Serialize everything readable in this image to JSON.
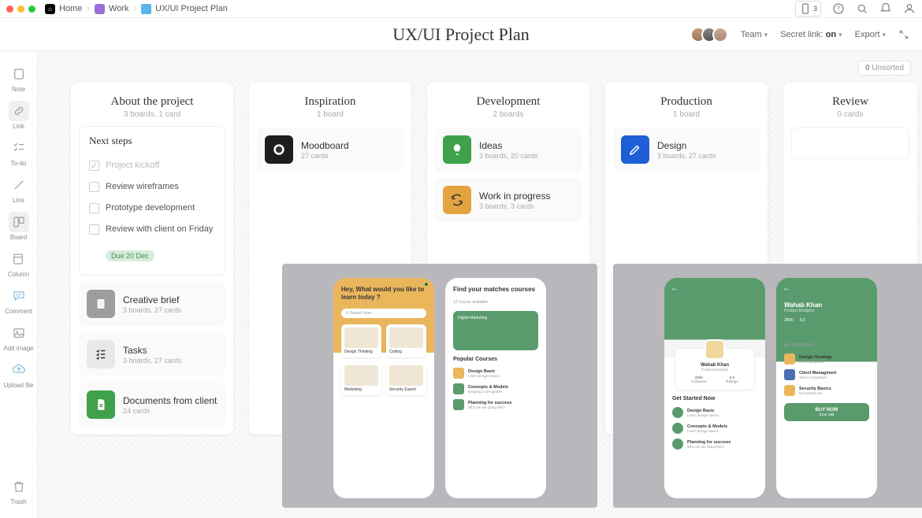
{
  "breadcrumb": {
    "home": "Home",
    "work": "Work",
    "project": "UX/UI Project Plan"
  },
  "device_count": "3",
  "page_title": "UX/UI Project Plan",
  "header": {
    "team": "Team",
    "secret": "Secret link:",
    "secret_state": "on",
    "export": "Export"
  },
  "sidebar": {
    "items": [
      "Note",
      "Link",
      "To-do",
      "Line",
      "Board",
      "Column",
      "Comment",
      "Add image",
      "Upload file"
    ],
    "trash": "Trash"
  },
  "unsorted": {
    "count": "0",
    "label": "Unsorted"
  },
  "columns": [
    {
      "title": "About the project",
      "sub": "3 boards, 1 card",
      "steps_title": "Next steps",
      "steps": [
        {
          "label": "Project kickoff",
          "done": true
        },
        {
          "label": "Review wireframes",
          "done": false
        },
        {
          "label": "Prototype development",
          "done": false
        },
        {
          "label": "Review with client on Friday",
          "done": false,
          "due": "Due 20 Dec"
        }
      ],
      "cards": [
        {
          "title": "Creative brief",
          "sub": "3 boards, 27 cards",
          "color": "#9d9d9d",
          "icon": "doc"
        },
        {
          "title": "Tasks",
          "sub": "3 boards, 27 cards",
          "color": "#e8e8e8",
          "icon": "checklist"
        },
        {
          "title": "Documents from client",
          "sub": "24 cards",
          "color": "#3fa24a",
          "icon": "file"
        }
      ]
    },
    {
      "title": "Inspiration",
      "sub": "1 board",
      "cards": [
        {
          "title": "Moodboard",
          "sub": "27 cards",
          "color": "#1e1e1e",
          "icon": "circle"
        }
      ]
    },
    {
      "title": "Development",
      "sub": "2 boards",
      "cards": [
        {
          "title": "Ideas",
          "sub": "3 boards, 20 cards",
          "color": "#3fa24a",
          "icon": "bulb"
        },
        {
          "title": "Work in progress",
          "sub": "3 boards, 3 cards",
          "color": "#e3a43f",
          "icon": "refresh"
        }
      ]
    },
    {
      "title": "Production",
      "sub": "1 board",
      "cards": [
        {
          "title": "Design",
          "sub": "3 boards, 27 cards",
          "color": "#1e5fd6",
          "icon": "pen"
        }
      ]
    },
    {
      "title": "Review",
      "sub": "0 cards",
      "cards": []
    }
  ],
  "mockups": {
    "phone1": {
      "hero": "Hey, What would you like to learn today ?",
      "search": "Search here",
      "tiles": [
        "Design Thinking",
        "Coding",
        "Marketing",
        "Security Expert"
      ]
    },
    "phone2": {
      "hero": "Find your matches courses",
      "sub": "13 Course available",
      "pill": "Digital Marketing",
      "section": "Popular Courses",
      "rows": [
        {
          "t": "Design Basic",
          "s": "Learn design basics"
        },
        {
          "t": "Concepts & Models",
          "s": "Bringing it all together"
        },
        {
          "t": "Planning for success",
          "s": "Why we are doing this?"
        }
      ]
    },
    "phone3": {
      "name": "Wahab Khan",
      "role": "Product Designer",
      "s1": "285K",
      "s1l": "Followers",
      "s2": "5.0",
      "s2l": "Ratings",
      "section": "Get Started Now",
      "rows": [
        {
          "t": "Design Basic",
          "s": "Learn design basics"
        },
        {
          "t": "Concepts & Models",
          "s": "Learn design basics"
        },
        {
          "t": "Planning for success",
          "s": "Why we are doing this?"
        }
      ]
    },
    "phone4": {
      "name": "Wahab Khan",
      "role": "Product Designer",
      "s1": "285K",
      "s2": "5.0",
      "section": "MY COURSES",
      "rows": [
        {
          "t": "Design Strategy",
          "s": "89% Completed"
        },
        {
          "t": "Client Managment",
          "s": "100% Completed"
        },
        {
          "t": "Security Basics",
          "s": "Not started yet"
        }
      ],
      "buy": "BUY NOW",
      "price": "from 18$"
    }
  }
}
